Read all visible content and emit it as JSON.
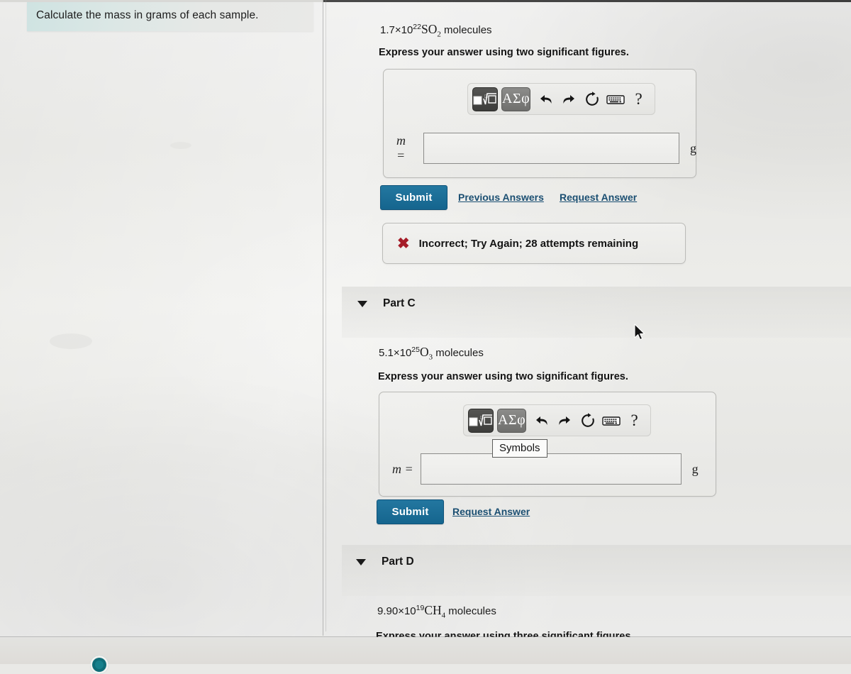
{
  "header": {
    "title": "Calculate the mass in grams of each sample."
  },
  "toolbar": {
    "template_button": "template-button",
    "symbols_label": "ΑΣφ",
    "undo": "↰",
    "redo": "↱",
    "reset": "↻",
    "keyboard": "⌨",
    "help": "?"
  },
  "tooltip": {
    "symbols": "Symbols"
  },
  "parts": [
    {
      "id": "part-b",
      "quantity": "1.7×10",
      "exponent": "22",
      "formula_main": "SO",
      "formula_sub": "2",
      "formula_tail": " molecules",
      "instruction": "Express your answer using two significant figures.",
      "variable": "m =",
      "answer_value": "",
      "answer_placeholder": "",
      "unit": "g",
      "submit_label": "Submit",
      "links": [
        "Previous Answers",
        "Request Answer"
      ],
      "feedback": {
        "icon": "✖",
        "text": "Incorrect; Try Again; 28 attempts remaining"
      }
    },
    {
      "id": "part-c",
      "part_label": "Part C",
      "quantity": "5.1×10",
      "exponent": "25",
      "formula_main": "O",
      "formula_sub": "3",
      "formula_tail": " molecules",
      "instruction": "Express your answer using two significant figures.",
      "variable": "m =",
      "answer_value": "",
      "answer_placeholder": "",
      "unit": "g",
      "submit_label": "Submit",
      "links": [
        "Request Answer"
      ]
    },
    {
      "id": "part-d",
      "part_label": "Part D",
      "quantity": "9.90×10",
      "exponent": "19",
      "formula_main": "CH",
      "formula_sub": "4",
      "formula_tail": " molecules",
      "instruction": "Express your answer using three significant figures."
    }
  ],
  "colors": {
    "submit_blue": "#15658e",
    "link_blue": "#1b4f72",
    "error_red": "#a51c28",
    "banner_tint": "#cfe3e2"
  }
}
